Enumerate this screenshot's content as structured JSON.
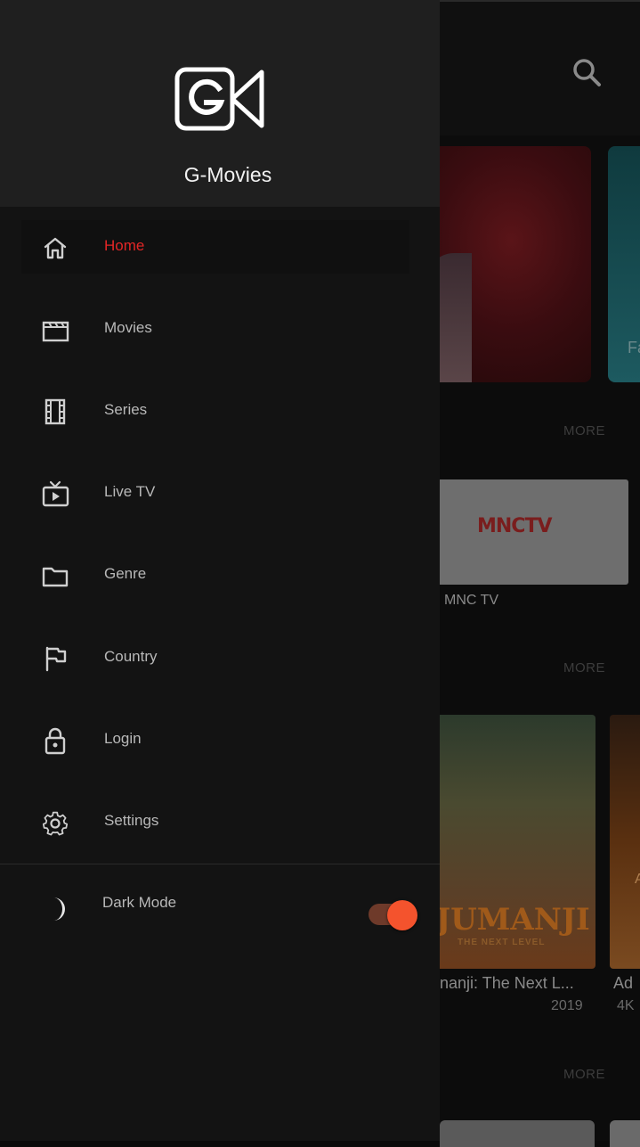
{
  "app": {
    "name": "G-Movies"
  },
  "nav": {
    "items": [
      {
        "label": "Home",
        "icon": "home-icon",
        "active": true
      },
      {
        "label": "Movies",
        "icon": "clapperboard-icon",
        "active": false
      },
      {
        "label": "Series",
        "icon": "film-strip-icon",
        "active": false
      },
      {
        "label": "Live TV",
        "icon": "live-tv-icon",
        "active": false
      },
      {
        "label": "Genre",
        "icon": "folder-icon",
        "active": false
      },
      {
        "label": "Country",
        "icon": "flag-icon",
        "active": false
      },
      {
        "label": "Login",
        "icon": "lock-icon",
        "active": false
      },
      {
        "label": "Settings",
        "icon": "gear-icon",
        "active": false
      }
    ]
  },
  "dark_mode": {
    "label": "Dark Mode",
    "enabled": true
  },
  "background": {
    "more_label": "MORE",
    "tv_channel": {
      "logo": "MNC",
      "logo_suffix": "TV",
      "name": "MNC TV"
    },
    "slider_partial_text": "Fa",
    "movies": [
      {
        "poster_title": "JUMANJI",
        "poster_subtitle": "THE NEXT LEVEL",
        "title": "nanji: The Next L...",
        "year": "2019"
      },
      {
        "title": "Ad",
        "year": "4K",
        "poster_partial_text": "A"
      }
    ]
  },
  "colors": {
    "accent": "#e32626",
    "toggle_on": "#f4532d",
    "drawer_bg": "#131313",
    "header_bg": "#1f1f1f"
  }
}
